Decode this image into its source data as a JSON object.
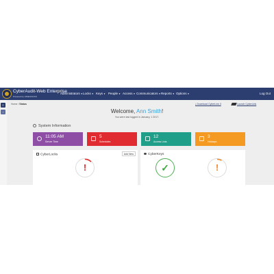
{
  "header": {
    "brand": "CyberAudit-Web Enterprise",
    "brand_sub": "Powered by VIDEOFICKS",
    "menus": [
      "Administrators",
      "Locks",
      "Keys",
      "People",
      "Access",
      "Communicators",
      "Reports",
      "Options"
    ],
    "logout": "Log Out"
  },
  "breadcrumb": {
    "home": "Home",
    "sep": "/",
    "current": "Status"
  },
  "links": {
    "download": "Download CyberLink 3",
    "launch": "Launch CyberLink"
  },
  "welcome": {
    "greeting": "Welcome,",
    "name": "Ann Smith",
    "suffix": "!",
    "last_login": "You were last logged in January, 1 2017."
  },
  "system_info": {
    "title": "System Information"
  },
  "cards": [
    {
      "value": "11:05 AM",
      "label": "Server Time",
      "color": "#8e4ea6",
      "icon": "clock-icon"
    },
    {
      "value": "5",
      "label": "Schedules",
      "color": "#e02b30",
      "icon": "calendar-icon"
    },
    {
      "value": "12",
      "label": "Access Lists",
      "color": "#1f9e8a",
      "icon": "list-icon"
    },
    {
      "value": "3",
      "label": "Holidays",
      "color": "#f49a23",
      "icon": "calendar-icon"
    }
  ],
  "panels": {
    "cyberlocks": {
      "title": "CyberLocks",
      "add_button": "Add New"
    },
    "cyberkeys": {
      "title": "CyberKeys"
    }
  },
  "colors": {
    "nav": "#2c3e70",
    "accent": "#3a9fd8",
    "ok": "#4caf50",
    "alert": "#e12b2b",
    "warn": "#f08a24"
  }
}
